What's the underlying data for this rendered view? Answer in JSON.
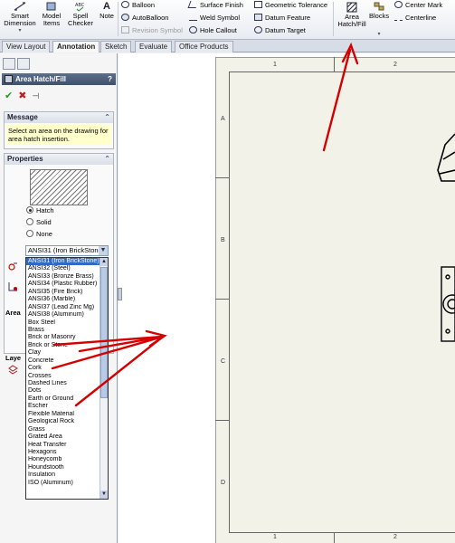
{
  "ribbon": {
    "smart_dimension": "Smart Dimension",
    "model_items": "Model Items",
    "spell_checker": "Spell Checker",
    "note": "Note",
    "balloon": "Balloon",
    "autoballoon": "AutoBalloon",
    "revision_symbol": "Revision Symbol",
    "surface_finish": "Surface Finish",
    "weld_symbol": "Weld Symbol",
    "hole_callout": "Hole Callout",
    "geometric_tolerance": "Geometric Tolerance",
    "datum_feature": "Datum Feature",
    "datum_target": "Datum Target",
    "area_hatch_fill": "Area Hatch/Fill",
    "blocks": "Blocks",
    "center_mark": "Center Mark",
    "centerline": "Centerline"
  },
  "tabs": [
    "View Layout",
    "Annotation",
    "Sketch",
    "Evaluate",
    "Office Products"
  ],
  "property_manager": {
    "title": "Area Hatch/Fill",
    "help": "?",
    "message_header": "Message",
    "message_text": "Select an area on the drawing for area hatch insertion.",
    "properties_header": "Properties",
    "radio_options": [
      "Hatch",
      "Solid",
      "None"
    ],
    "selected_radio": "Hatch",
    "combo_value": "ANSI31 (Iron BrickStone)",
    "area_header_stub": "Area",
    "layer_header_stub": "Laye"
  },
  "pattern_list": [
    "ANSI31 (Iron BrickStone)",
    "ANSI32 (Steel)",
    "ANSI33 (Bronze Brass)",
    "ANSI34 (Plastic Rubber)",
    "ANSI35 (Fire Brick)",
    "ANSI36 (Marble)",
    "ANSI37 (Lead Zinc Mg)",
    "ANSI38 (Aluminum)",
    "Box Steel",
    "Brass",
    "Brick or Masonry",
    "Brick or Stone",
    "Clay",
    "Concrete",
    "Cork",
    "Crosses",
    "Dashed Lines",
    "Dots",
    "Earth or Ground",
    "Escher",
    "Flexible Material",
    "Geological Rock",
    "Grass",
    "Grated Area",
    "Heat Transfer",
    "Hexagons",
    "Honeycomb",
    "Houndstooth",
    "Insulation",
    "ISO (Aluminum)"
  ],
  "selected_pattern": "ANSI31 (Iron BrickStone)",
  "sheet": {
    "col_labels": [
      "1",
      "2"
    ],
    "row_labels": [
      "A",
      "B",
      "C",
      "D"
    ]
  },
  "colors": {
    "annotation_arrows": "#d40000",
    "selection": "#316ac5"
  }
}
